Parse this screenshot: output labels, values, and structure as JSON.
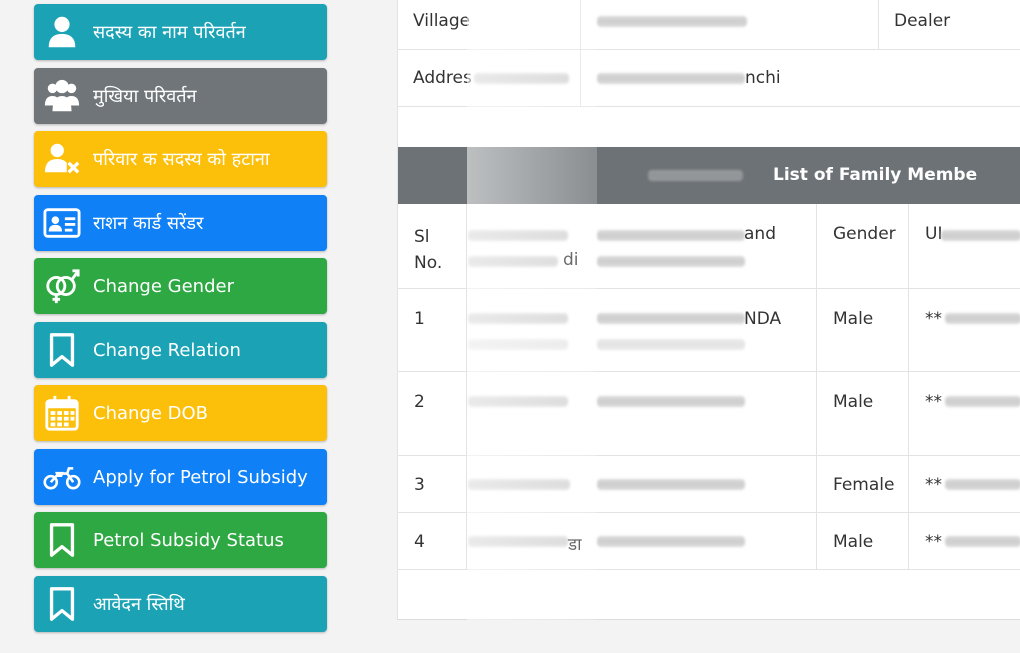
{
  "sidebar": {
    "items": [
      {
        "label": "सदस्य का नाम परिवर्तन",
        "color": "#1ba3b5",
        "icon": "user-icon"
      },
      {
        "label": "मुखिया परिवर्तन",
        "color": "#6f7579",
        "icon": "users-group-icon"
      },
      {
        "label": "परिवार क सदस्य को हटाना",
        "color": "#fcbf0a",
        "icon": "user-remove-icon"
      },
      {
        "label": "राशन कार्ड सरेंडर",
        "color": "#0f80f5",
        "icon": "id-card-icon"
      },
      {
        "label": "Change Gender",
        "color": "#2ea842",
        "icon": "gender-icon"
      },
      {
        "label": "Change Relation",
        "color": "#1ba3b5",
        "icon": "bookmark-icon"
      },
      {
        "label": "Change DOB",
        "color": "#fcbf0a",
        "icon": "calendar-icon"
      },
      {
        "label": "Apply for Petrol Subsidy",
        "color": "#0f80f5",
        "icon": "motorcycle-icon"
      },
      {
        "label": "Petrol Subsidy Status",
        "color": "#2ea842",
        "icon": "bookmark-icon"
      },
      {
        "label": "आवेदन स्तिथि",
        "color": "#1ba3b5",
        "icon": "bookmark-icon"
      }
    ]
  },
  "info": {
    "village_label": "Village",
    "dealer_label": "Dealer",
    "address_label": "Addres",
    "address_value_suffix": "nchi"
  },
  "table": {
    "title": "List of Family Membe",
    "headers": {
      "sl": "Sl No.",
      "name_suffix": "and",
      "name_suffix2": "di",
      "gender": "Gender",
      "uid": "UI"
    },
    "rows": [
      {
        "sl": "1",
        "name_suffix": "NDA",
        "gender": "Male",
        "uid": "**"
      },
      {
        "sl": "2",
        "name_suffix": "",
        "gender": "Male",
        "uid": "**"
      },
      {
        "sl": "3",
        "name_suffix": "",
        "gender": "Female",
        "uid": "**"
      },
      {
        "sl": "4",
        "name_suffix": "डा",
        "gender": "Male",
        "uid": "**"
      }
    ]
  }
}
